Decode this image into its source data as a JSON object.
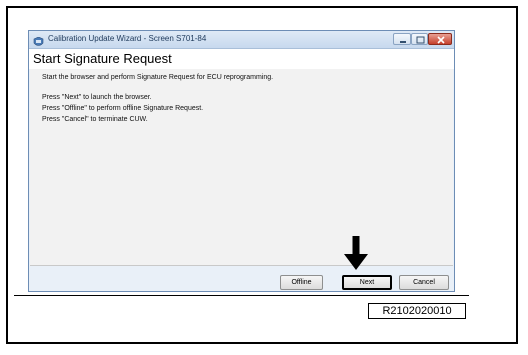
{
  "window": {
    "title": "Calibration Update Wizard - Screen S701-84",
    "heading": "Start Signature Request"
  },
  "content": {
    "lines": [
      "Start the browser and perform Signature Request for ECU reprogramming.",
      "Press \"Next\" to launch the browser.",
      "Press \"Offline\" to perform offline Signature Request.",
      "Press \"Cancel\" to terminate CUW."
    ]
  },
  "buttons": {
    "offline": "Offline",
    "next": "Next",
    "cancel": "Cancel"
  },
  "figure": {
    "caption_id": "R2102020010"
  },
  "icons": {
    "app": "calibration-app-icon",
    "minimize": "minimize-icon",
    "maximize": "maximize-icon",
    "close": "close-icon",
    "pointer": "down-arrow-icon"
  },
  "colors": {
    "close_button": "#c6402c",
    "window_border": "#6d8db5",
    "content_background": "#f2f2f2"
  }
}
